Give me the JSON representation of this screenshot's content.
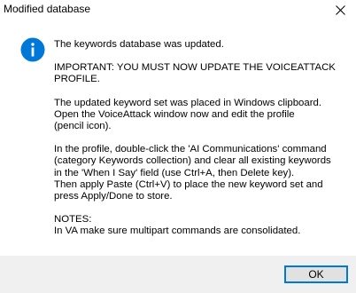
{
  "window": {
    "title": "Modified database",
    "close_icon": "close-icon"
  },
  "message": {
    "icon": "info-icon",
    "icon_color": "#0078d7",
    "paragraphs": [
      "The keywords database was updated.",
      "IMPORTANT: YOU MUST NOW UPDATE THE VOICEATTACK\nPROFILE.",
      "The updated keyword set was placed in Windows clipboard.\nOpen the VoiceAttack window now and edit the profile\n(pencil icon).",
      "In the profile, double-click the 'AI Communications' command\n(category Keywords collection) and clear all existing keywords\nin the 'When I Say' field (use Ctrl+A, then Delete key).\nThen apply Paste (Ctrl+V) to place the new keyword set and\npress Apply/Done to store.",
      "NOTES:\nIn VA make sure multipart commands are consolidated."
    ]
  },
  "footer": {
    "ok_label": "OK",
    "accent": "#0078d7"
  }
}
